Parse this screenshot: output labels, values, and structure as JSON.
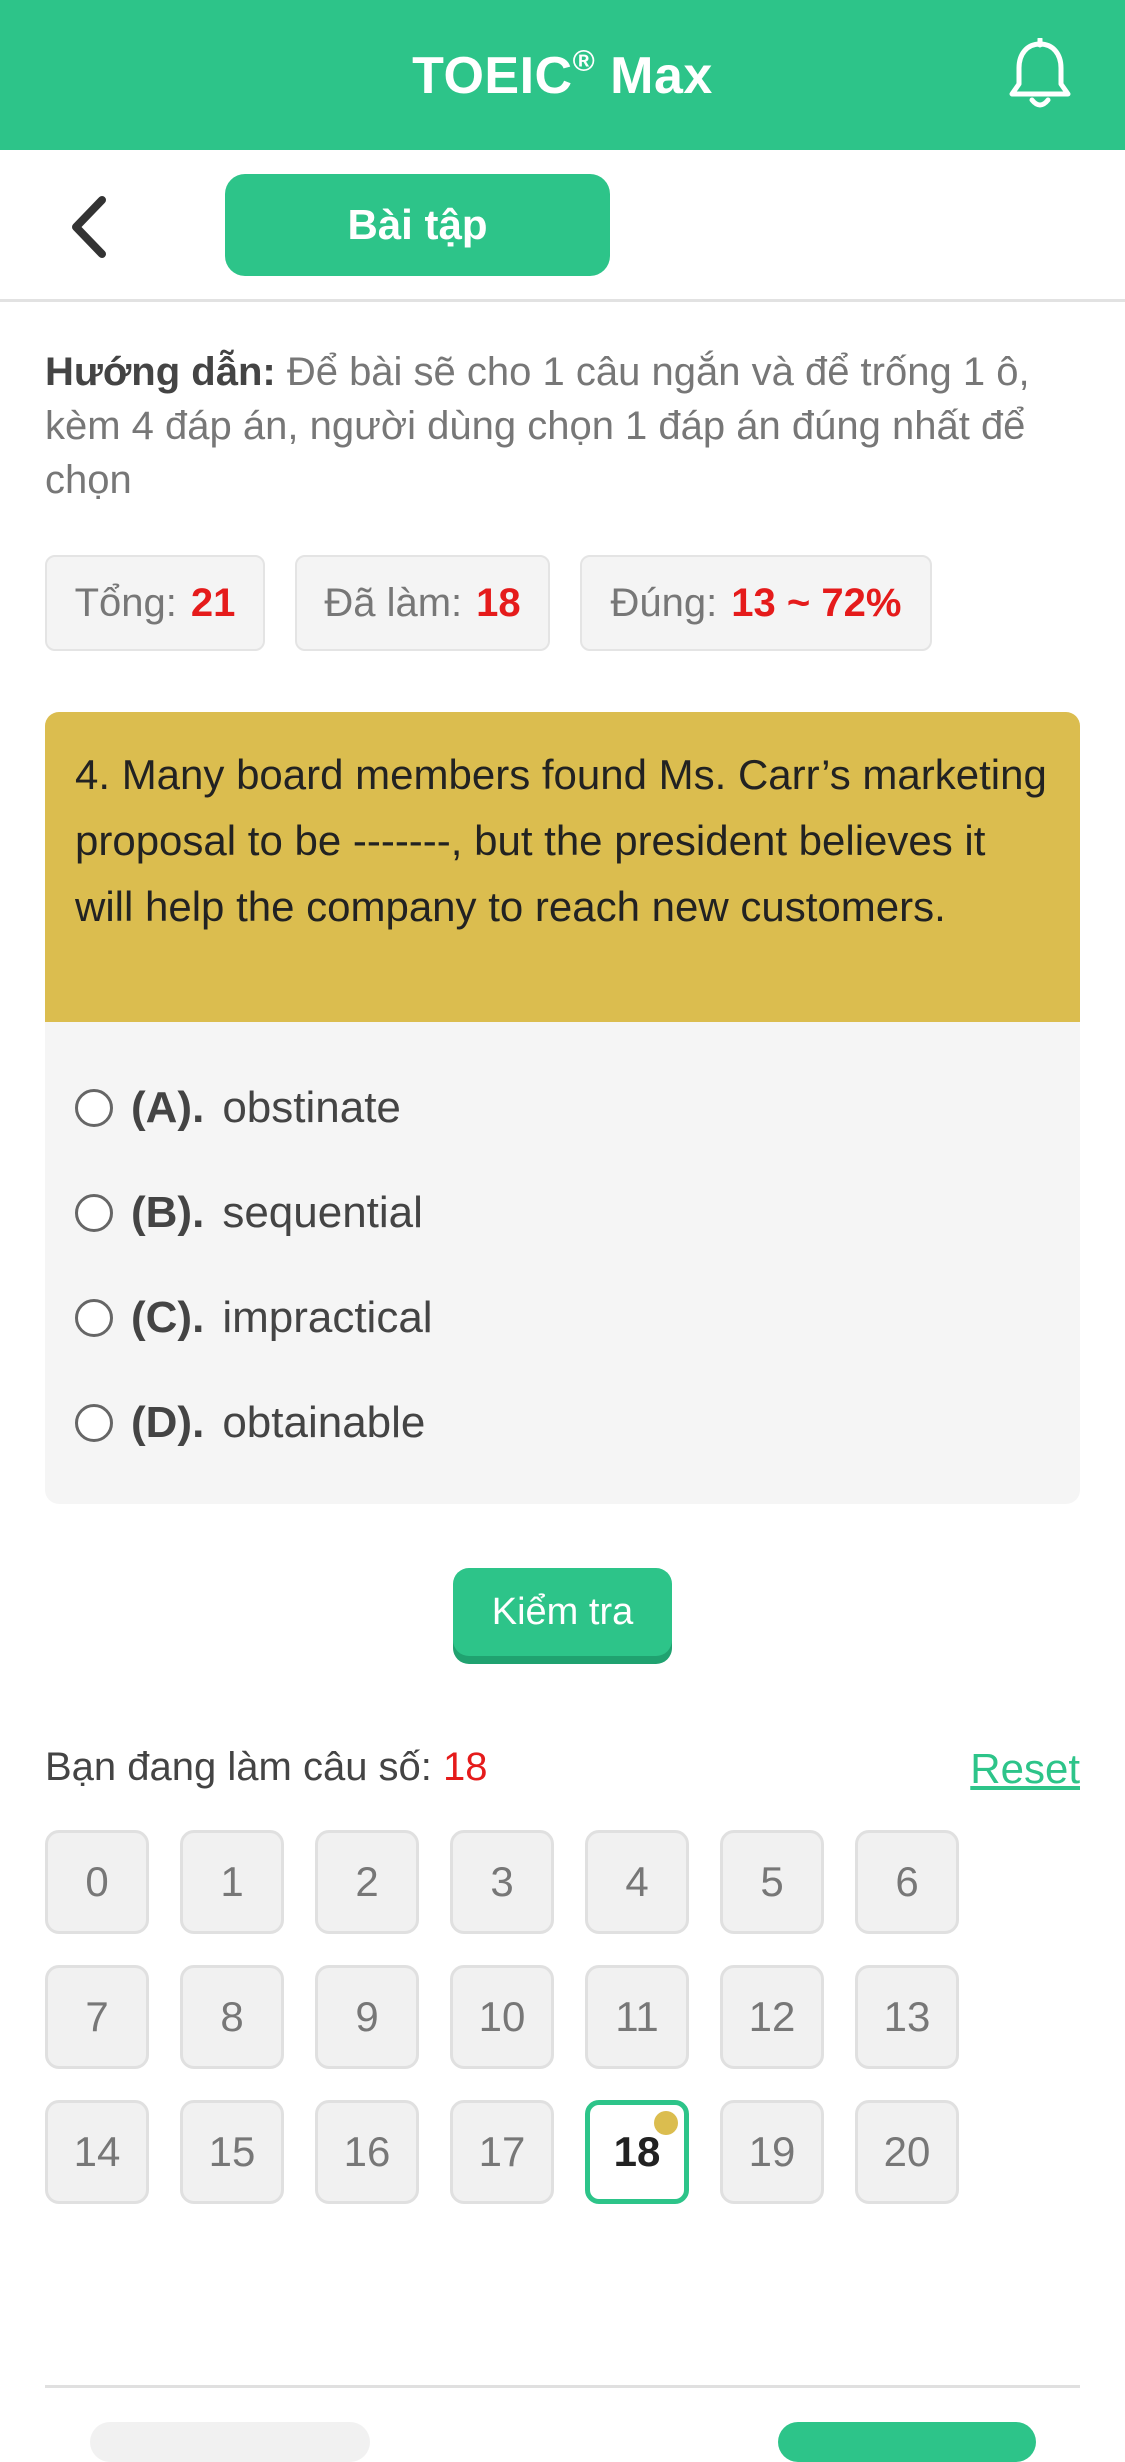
{
  "header": {
    "title": "TOEIC",
    "title_mark": "®",
    "title_suffix": " Max",
    "bell_icon": "bell-icon"
  },
  "subbar": {
    "back_icon": "chevron-left-icon",
    "tab_label": "Bài tập"
  },
  "guide": {
    "label": "Hướng dẫn:",
    "text": " Để bài sẽ cho 1 câu ngắn và để trống 1 ô, kèm 4 đáp án, người dùng chọn 1 đáp án đúng nhất để chọn"
  },
  "stats": [
    {
      "label": "Tổng:",
      "value": "21"
    },
    {
      "label": "Đã làm:",
      "value": "18"
    },
    {
      "label": "Đúng:",
      "value": "13 ~ 72%"
    }
  ],
  "question": {
    "text": "4. Many board members found Ms. Carr’s marketing proposal to be -------, but the president believes it will help the company to reach new customers.",
    "options": [
      {
        "letter": "(A).",
        "text": "obstinate"
      },
      {
        "letter": "(B).",
        "text": "sequential"
      },
      {
        "letter": "(C).",
        "text": "impractical"
      },
      {
        "letter": "(D).",
        "text": "obtainable"
      }
    ]
  },
  "check_button": "Kiểm tra",
  "progress": {
    "label": "Bạn đang làm câu số:",
    "current": "18",
    "reset_label": "Reset",
    "numbers": [
      "0",
      "1",
      "2",
      "3",
      "4",
      "5",
      "6",
      "7",
      "8",
      "9",
      "10",
      "11",
      "12",
      "13",
      "14",
      "15",
      "16",
      "17",
      "18",
      "19",
      "20"
    ],
    "active_index": 18
  },
  "colors": {
    "brand": "#2dc489",
    "question_bg": "#dbbd4f",
    "highlight_red": "#e51b1b"
  }
}
